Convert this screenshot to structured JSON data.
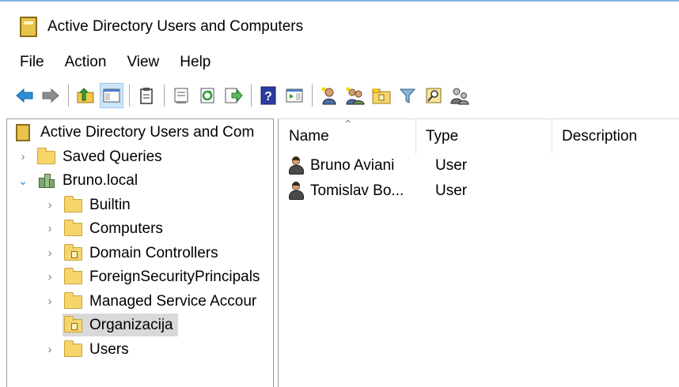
{
  "window": {
    "title": "Active Directory Users and Computers",
    "icon": "ad-book-icon"
  },
  "menu": [
    "File",
    "Action",
    "View",
    "Help"
  ],
  "toolbar": {
    "buttons": [
      "back-arrow-icon",
      "forward-arrow-icon",
      "up-folder-icon",
      "show-console-tree-icon",
      "clipboard-icon",
      "properties-icon",
      "refresh-icon",
      "export-list-icon",
      "help-icon",
      "action-pane-icon",
      "new-user-icon",
      "new-group-icon",
      "new-ou-icon",
      "filter-icon",
      "find-icon",
      "delegate-icon"
    ]
  },
  "tree": {
    "root": "Active Directory Users and Com",
    "items": [
      {
        "label": "Saved Queries",
        "level": 1,
        "expander": "collapsed",
        "icon": "folder"
      },
      {
        "label": "Bruno.local",
        "level": 1,
        "expander": "expanded",
        "icon": "domain"
      },
      {
        "label": "Builtin",
        "level": 2,
        "expander": "collapsed",
        "icon": "folder"
      },
      {
        "label": "Computers",
        "level": 2,
        "expander": "collapsed",
        "icon": "folder"
      },
      {
        "label": "Domain Controllers",
        "level": 2,
        "expander": "collapsed",
        "icon": "ou"
      },
      {
        "label": "ForeignSecurityPrincipals",
        "level": 2,
        "expander": "collapsed",
        "icon": "folder"
      },
      {
        "label": "Managed Service Accour",
        "level": 2,
        "expander": "collapsed",
        "icon": "folder"
      },
      {
        "label": "Organizacija",
        "level": 2,
        "expander": "none",
        "icon": "ou",
        "selected": true
      },
      {
        "label": "Users",
        "level": 2,
        "expander": "collapsed",
        "icon": "folder"
      }
    ]
  },
  "list": {
    "columns": [
      "Name",
      "Type",
      "Description"
    ],
    "rows": [
      {
        "name": "Bruno Aviani",
        "type": "User"
      },
      {
        "name": "Tomislav Bo...",
        "type": "User"
      }
    ]
  },
  "colors": {
    "selection": "#d9d9d9",
    "accent": "#2b8fd6"
  }
}
